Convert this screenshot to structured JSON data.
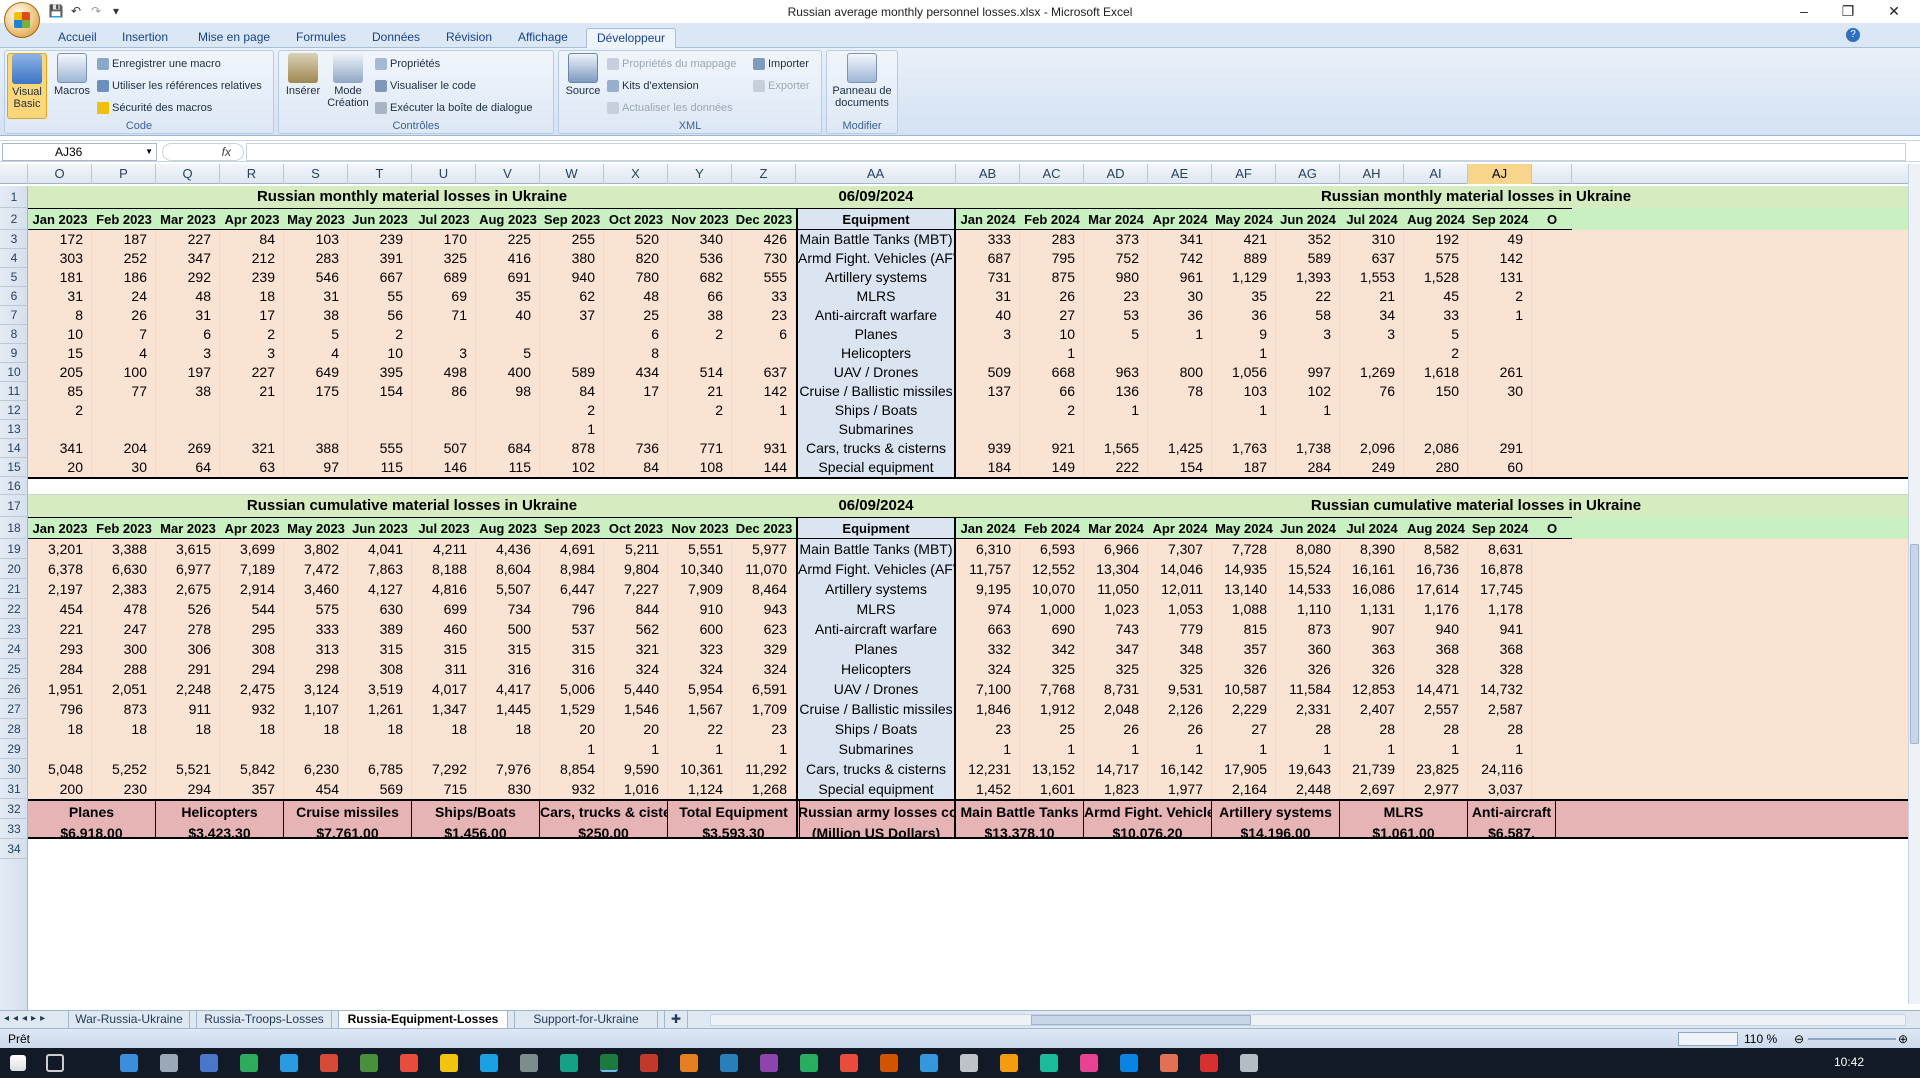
{
  "window": {
    "title": "Russian average monthly personnel losses.xlsx - Microsoft Excel",
    "minimize": "–",
    "restore": "❐",
    "close": "✕"
  },
  "ribbon_tabs": [
    "Accueil",
    "Insertion",
    "Mise en page",
    "Formules",
    "Données",
    "Révision",
    "Affichage",
    "Développeur"
  ],
  "ribbon": {
    "code": {
      "label": "Code",
      "visual_basic": "Visual Basic",
      "macros": "Macros",
      "record": "Enregistrer une macro",
      "relative": "Utiliser les références relatives",
      "security": "Sécurité des macros"
    },
    "controls": {
      "label": "Contrôles",
      "insert": "Insérer",
      "design_mode": "Mode Création",
      "properties": "Propriétés",
      "view_code": "Visualiser le code",
      "run_dialog": "Exécuter la boîte de dialogue"
    },
    "xml": {
      "label": "XML",
      "source": "Source",
      "map_props": "Propriétés du mappage",
      "packs": "Kits d'extension",
      "refresh": "Actualiser les données",
      "import": "Importer",
      "export": "Exporter"
    },
    "modify": {
      "label": "Modifier",
      "doc_panel": "Panneau de documents"
    }
  },
  "formula_bar": {
    "name_box": "AJ36",
    "fx": "fx",
    "value": ""
  },
  "columns": [
    {
      "letter": "O",
      "month": "Jan 2023"
    },
    {
      "letter": "P",
      "month": "Feb 2023"
    },
    {
      "letter": "Q",
      "month": "Mar 2023"
    },
    {
      "letter": "R",
      "month": "Apr 2023"
    },
    {
      "letter": "S",
      "month": "May 2023"
    },
    {
      "letter": "T",
      "month": "Jun 2023"
    },
    {
      "letter": "U",
      "month": "Jul 2023"
    },
    {
      "letter": "V",
      "month": "Aug 2023"
    },
    {
      "letter": "W",
      "month": "Sep 2023"
    },
    {
      "letter": "X",
      "month": "Oct 2023"
    },
    {
      "letter": "Y",
      "month": "Nov 2023"
    },
    {
      "letter": "Z",
      "month": "Dec 2023"
    },
    {
      "letter": "AA",
      "month": "Equipment"
    },
    {
      "letter": "AB",
      "month": "Jan 2024"
    },
    {
      "letter": "AC",
      "month": "Feb 2024"
    },
    {
      "letter": "AD",
      "month": "Mar 2024"
    },
    {
      "letter": "AE",
      "month": "Apr 2024"
    },
    {
      "letter": "AF",
      "month": "May 2024"
    },
    {
      "letter": "AG",
      "month": "Jun 2024"
    },
    {
      "letter": "AH",
      "month": "Jul 2024"
    },
    {
      "letter": "AI",
      "month": "Aug 2024"
    },
    {
      "letter": "AJ",
      "month": "Sep 2024"
    },
    {
      "letter": "",
      "month": "O"
    }
  ],
  "selected_column": "AJ",
  "row_numbers": [
    "1",
    "2",
    "3",
    "4",
    "5",
    "6",
    "7",
    "8",
    "9",
    "10",
    "11",
    "12",
    "13",
    "14",
    "15",
    "16",
    "17",
    "18",
    "19",
    "20",
    "21",
    "22",
    "23",
    "24",
    "25",
    "26",
    "27",
    "28",
    "29",
    "30",
    "31",
    "32",
    "33",
    "34"
  ],
  "monthly": {
    "title_left": "Russian monthly material losses in Ukraine",
    "date": "06/09/2024",
    "title_right": "Russian monthly material losses in Ukraine",
    "rows": [
      {
        "label": "Main Battle Tanks (MBT)",
        "y2023": [
          "172",
          "187",
          "227",
          "84",
          "103",
          "239",
          "170",
          "225",
          "255",
          "520",
          "340",
          "426"
        ],
        "y2024": [
          "333",
          "283",
          "373",
          "341",
          "421",
          "352",
          "310",
          "192",
          "49"
        ]
      },
      {
        "label": "Armd Fight. Vehicles (AFV)",
        "y2023": [
          "303",
          "252",
          "347",
          "212",
          "283",
          "391",
          "325",
          "416",
          "380",
          "820",
          "536",
          "730"
        ],
        "y2024": [
          "687",
          "795",
          "752",
          "742",
          "889",
          "589",
          "637",
          "575",
          "142"
        ]
      },
      {
        "label": "Artillery systems",
        "y2023": [
          "181",
          "186",
          "292",
          "239",
          "546",
          "667",
          "689",
          "691",
          "940",
          "780",
          "682",
          "555"
        ],
        "y2024": [
          "731",
          "875",
          "980",
          "961",
          "1,129",
          "1,393",
          "1,553",
          "1,528",
          "131"
        ]
      },
      {
        "label": "MLRS",
        "y2023": [
          "31",
          "24",
          "48",
          "18",
          "31",
          "55",
          "69",
          "35",
          "62",
          "48",
          "66",
          "33"
        ],
        "y2024": [
          "31",
          "26",
          "23",
          "30",
          "35",
          "22",
          "21",
          "45",
          "2"
        ]
      },
      {
        "label": "Anti-aircraft warfare",
        "y2023": [
          "8",
          "26",
          "31",
          "17",
          "38",
          "56",
          "71",
          "40",
          "37",
          "25",
          "38",
          "23"
        ],
        "y2024": [
          "40",
          "27",
          "53",
          "36",
          "36",
          "58",
          "34",
          "33",
          "1"
        ]
      },
      {
        "label": "Planes",
        "y2023": [
          "10",
          "7",
          "6",
          "2",
          "5",
          "2",
          "",
          "",
          "",
          "6",
          "2",
          "6"
        ],
        "y2024": [
          "3",
          "10",
          "5",
          "1",
          "9",
          "3",
          "3",
          "5",
          ""
        ]
      },
      {
        "label": "Helicopters",
        "y2023": [
          "15",
          "4",
          "3",
          "3",
          "4",
          "10",
          "3",
          "5",
          "",
          "8",
          "",
          ""
        ],
        "y2024": [
          "",
          "1",
          "",
          "",
          "1",
          "",
          "",
          "2",
          ""
        ]
      },
      {
        "label": "UAV / Drones",
        "y2023": [
          "205",
          "100",
          "197",
          "227",
          "649",
          "395",
          "498",
          "400",
          "589",
          "434",
          "514",
          "637"
        ],
        "y2024": [
          "509",
          "668",
          "963",
          "800",
          "1,056",
          "997",
          "1,269",
          "1,618",
          "261"
        ]
      },
      {
        "label": "Cruise / Ballistic missiles",
        "y2023": [
          "85",
          "77",
          "38",
          "21",
          "175",
          "154",
          "86",
          "98",
          "84",
          "17",
          "21",
          "142"
        ],
        "y2024": [
          "137",
          "66",
          "136",
          "78",
          "103",
          "102",
          "76",
          "150",
          "30"
        ]
      },
      {
        "label": "Ships / Boats",
        "y2023": [
          "2",
          "",
          "",
          "",
          "",
          "",
          "",
          "",
          "2",
          "",
          "2",
          "1"
        ],
        "y2024": [
          "",
          "2",
          "1",
          "",
          "1",
          "1",
          "",
          "",
          ""
        ]
      },
      {
        "label": "Submarines",
        "y2023": [
          "",
          "",
          "",
          "",
          "",
          "",
          "",
          "",
          "1",
          "",
          "",
          ""
        ],
        "y2024": [
          "",
          "",
          "",
          "",
          "",
          "",
          "",
          "",
          ""
        ]
      },
      {
        "label": "Cars, trucks & cisterns",
        "y2023": [
          "341",
          "204",
          "269",
          "321",
          "388",
          "555",
          "507",
          "684",
          "878",
          "736",
          "771",
          "931"
        ],
        "y2024": [
          "939",
          "921",
          "1,565",
          "1,425",
          "1,763",
          "1,738",
          "2,096",
          "2,086",
          "291"
        ]
      },
      {
        "label": "Special equipment",
        "y2023": [
          "20",
          "30",
          "64",
          "63",
          "97",
          "115",
          "146",
          "115",
          "102",
          "84",
          "108",
          "144"
        ],
        "y2024": [
          "184",
          "149",
          "222",
          "154",
          "187",
          "284",
          "249",
          "280",
          "60"
        ]
      }
    ]
  },
  "cumulative": {
    "title_left": "Russian cumulative material losses in Ukraine",
    "date": "06/09/2024",
    "title_right": "Russian cumulative material losses in Ukraine",
    "rows": [
      {
        "label": "Main Battle Tanks (MBT)",
        "y2023": [
          "3,201",
          "3,388",
          "3,615",
          "3,699",
          "3,802",
          "4,041",
          "4,211",
          "4,436",
          "4,691",
          "5,211",
          "5,551",
          "5,977"
        ],
        "y2024": [
          "6,310",
          "6,593",
          "6,966",
          "7,307",
          "7,728",
          "8,080",
          "8,390",
          "8,582",
          "8,631"
        ]
      },
      {
        "label": "Armd Fight. Vehicles (AFV)",
        "y2023": [
          "6,378",
          "6,630",
          "6,977",
          "7,189",
          "7,472",
          "7,863",
          "8,188",
          "8,604",
          "8,984",
          "9,804",
          "10,340",
          "11,070"
        ],
        "y2024": [
          "11,757",
          "12,552",
          "13,304",
          "14,046",
          "14,935",
          "15,524",
          "16,161",
          "16,736",
          "16,878"
        ]
      },
      {
        "label": "Artillery systems",
        "y2023": [
          "2,197",
          "2,383",
          "2,675",
          "2,914",
          "3,460",
          "4,127",
          "4,816",
          "5,507",
          "6,447",
          "7,227",
          "7,909",
          "8,464"
        ],
        "y2024": [
          "9,195",
          "10,070",
          "11,050",
          "12,011",
          "13,140",
          "14,533",
          "16,086",
          "17,614",
          "17,745"
        ]
      },
      {
        "label": "MLRS",
        "y2023": [
          "454",
          "478",
          "526",
          "544",
          "575",
          "630",
          "699",
          "734",
          "796",
          "844",
          "910",
          "943"
        ],
        "y2024": [
          "974",
          "1,000",
          "1,023",
          "1,053",
          "1,088",
          "1,110",
          "1,131",
          "1,176",
          "1,178"
        ]
      },
      {
        "label": "Anti-aircraft warfare",
        "y2023": [
          "221",
          "247",
          "278",
          "295",
          "333",
          "389",
          "460",
          "500",
          "537",
          "562",
          "600",
          "623"
        ],
        "y2024": [
          "663",
          "690",
          "743",
          "779",
          "815",
          "873",
          "907",
          "940",
          "941"
        ]
      },
      {
        "label": "Planes",
        "y2023": [
          "293",
          "300",
          "306",
          "308",
          "313",
          "315",
          "315",
          "315",
          "315",
          "321",
          "323",
          "329"
        ],
        "y2024": [
          "332",
          "342",
          "347",
          "348",
          "357",
          "360",
          "363",
          "368",
          "368"
        ]
      },
      {
        "label": "Helicopters",
        "y2023": [
          "284",
          "288",
          "291",
          "294",
          "298",
          "308",
          "311",
          "316",
          "316",
          "324",
          "324",
          "324"
        ],
        "y2024": [
          "324",
          "325",
          "325",
          "325",
          "326",
          "326",
          "326",
          "328",
          "328"
        ]
      },
      {
        "label": "UAV / Drones",
        "y2023": [
          "1,951",
          "2,051",
          "2,248",
          "2,475",
          "3,124",
          "3,519",
          "4,017",
          "4,417",
          "5,006",
          "5,440",
          "5,954",
          "6,591"
        ],
        "y2024": [
          "7,100",
          "7,768",
          "8,731",
          "9,531",
          "10,587",
          "11,584",
          "12,853",
          "14,471",
          "14,732"
        ]
      },
      {
        "label": "Cruise / Ballistic missiles",
        "y2023": [
          "796",
          "873",
          "911",
          "932",
          "1,107",
          "1,261",
          "1,347",
          "1,445",
          "1,529",
          "1,546",
          "1,567",
          "1,709"
        ],
        "y2024": [
          "1,846",
          "1,912",
          "2,048",
          "2,126",
          "2,229",
          "2,331",
          "2,407",
          "2,557",
          "2,587"
        ]
      },
      {
        "label": "Ships / Boats",
        "y2023": [
          "18",
          "18",
          "18",
          "18",
          "18",
          "18",
          "18",
          "18",
          "20",
          "20",
          "22",
          "23"
        ],
        "y2024": [
          "23",
          "25",
          "26",
          "26",
          "27",
          "28",
          "28",
          "28",
          "28"
        ]
      },
      {
        "label": "Submarines",
        "y2023": [
          "",
          "",
          "",
          "",
          "",
          "",
          "",
          "",
          "1",
          "1",
          "1",
          "1"
        ],
        "y2024": [
          "1",
          "1",
          "1",
          "1",
          "1",
          "1",
          "1",
          "1",
          "1"
        ]
      },
      {
        "label": "Cars, trucks & cisterns",
        "y2023": [
          "5,048",
          "5,252",
          "5,521",
          "5,842",
          "6,230",
          "6,785",
          "7,292",
          "7,976",
          "8,854",
          "9,590",
          "10,361",
          "11,292"
        ],
        "y2024": [
          "12,231",
          "13,152",
          "14,717",
          "16,142",
          "17,905",
          "19,643",
          "21,739",
          "23,825",
          "24,116"
        ]
      },
      {
        "label": "Special equipment",
        "y2023": [
          "200",
          "230",
          "294",
          "357",
          "454",
          "569",
          "715",
          "830",
          "932",
          "1,016",
          "1,124",
          "1,268"
        ],
        "y2024": [
          "1,452",
          "1,601",
          "1,823",
          "1,977",
          "2,164",
          "2,448",
          "2,697",
          "2,977",
          "3,037"
        ]
      }
    ]
  },
  "costs": {
    "center_line1": "Russian army losses cost",
    "center_line2": "(Million US Dollars)",
    "left": [
      {
        "label": "Planes",
        "value": "$6,918.00"
      },
      {
        "label": "Helicopters",
        "value": "$3,423.30"
      },
      {
        "label": "Cruise missiles",
        "value": "$7,761.00"
      },
      {
        "label": "Ships/Boats",
        "value": "$1,456.00"
      },
      {
        "label": "Cars, trucks & cisterns",
        "value": "$250.00"
      },
      {
        "label": "Total Equipment",
        "value": "$3,593.30"
      }
    ],
    "right": [
      {
        "label": "Main Battle Tanks",
        "value": "$13,378.10"
      },
      {
        "label": "Armd Fight. Vehicles",
        "value": "$10,076.20"
      },
      {
        "label": "Artillery systems",
        "value": "$14,196.00"
      },
      {
        "label": "MLRS",
        "value": "$1,061.00"
      },
      {
        "label": "Anti-aircraft",
        "value": "$6,587."
      }
    ]
  },
  "sheet_tabs": [
    "War-Russia-Ukraine",
    "Russia-Troops-Losses",
    "Russia-Equipment-Losses",
    "Support-for-Ukraine"
  ],
  "active_sheet": "Russia-Equipment-Losses",
  "status": {
    "mode": "Prêt",
    "zoom": "110 %"
  },
  "taskbar": {
    "time": "10:42"
  },
  "colors": {
    "header_green": "#d6ecc0",
    "month_green": "#c8f0c0",
    "data_peach": "#fbe3d4",
    "equip_blue": "#dbe5f1",
    "cost_pink": "#e6b4b4"
  }
}
